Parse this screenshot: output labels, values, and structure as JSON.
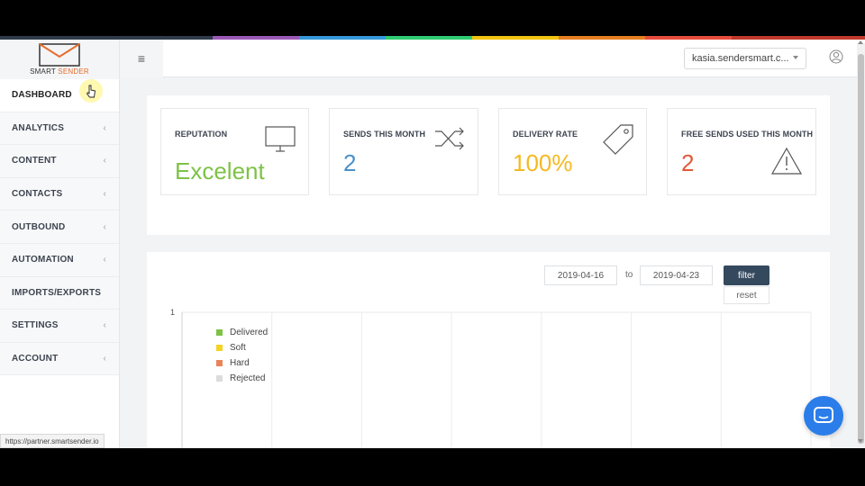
{
  "brand": {
    "logo_text_part1": "SMART",
    "logo_text_part2": "SENDER",
    "accent_color": "#e86c2c"
  },
  "top_strip_colors": [
    "#2f3b4a",
    "#9b59b6",
    "#3498db",
    "#2ecc71",
    "#f1c40f",
    "#e67e22",
    "#e74c3c",
    "#c0392b"
  ],
  "sidebar": {
    "items": [
      {
        "label": "DASHBOARD",
        "has_chevron": false,
        "active": true
      },
      {
        "label": "ANALYTICS",
        "has_chevron": true
      },
      {
        "label": "CONTENT",
        "has_chevron": true
      },
      {
        "label": "CONTACTS",
        "has_chevron": true
      },
      {
        "label": "OUTBOUND",
        "has_chevron": true
      },
      {
        "label": "AUTOMATION",
        "has_chevron": true
      },
      {
        "label": "IMPORTS/EXPORTS",
        "has_chevron": false
      },
      {
        "label": "SETTINGS",
        "has_chevron": true
      },
      {
        "label": "ACCOUNT",
        "has_chevron": true
      }
    ],
    "chevron_glyph": "‹"
  },
  "header": {
    "menu_icon": "≡",
    "account_select_value": "kasia.sendersmart.c..."
  },
  "stats": {
    "reputation": {
      "title": "REPUTATION",
      "value": "Excelent",
      "color": "#7dc246",
      "icon": "monitor-icon"
    },
    "sends": {
      "title": "SENDS THIS MONTH",
      "value": "2",
      "color": "#4a90c8",
      "icon": "shuffle-icon"
    },
    "delivery": {
      "title": "DELIVERY RATE",
      "value": "100%",
      "color": "#f5b921",
      "icon": "tag-icon"
    },
    "free_sends": {
      "title": "FREE SENDS USED THIS MONTH",
      "value": "2",
      "color": "#e05a3a",
      "icon": "warning-icon"
    }
  },
  "filter": {
    "date_from": "2019-04-16",
    "to_label": "to",
    "date_to": "2019-04-23",
    "filter_label": "filter",
    "reset_label": "reset"
  },
  "chart_data": {
    "type": "line",
    "y_tick_labels": [
      "1"
    ],
    "series": [
      {
        "name": "Delivered",
        "color": "#7dc246"
      },
      {
        "name": "Soft",
        "color": "#f5d321"
      },
      {
        "name": "Hard",
        "color": "#e8845a"
      },
      {
        "name": "Rejected",
        "color": "#dcdcdc"
      }
    ],
    "grid": true,
    "legend_position": "top-left"
  },
  "statusbar": {
    "url": "https://partner.smartsender.io"
  },
  "chat": {
    "icon": "chat-icon"
  }
}
